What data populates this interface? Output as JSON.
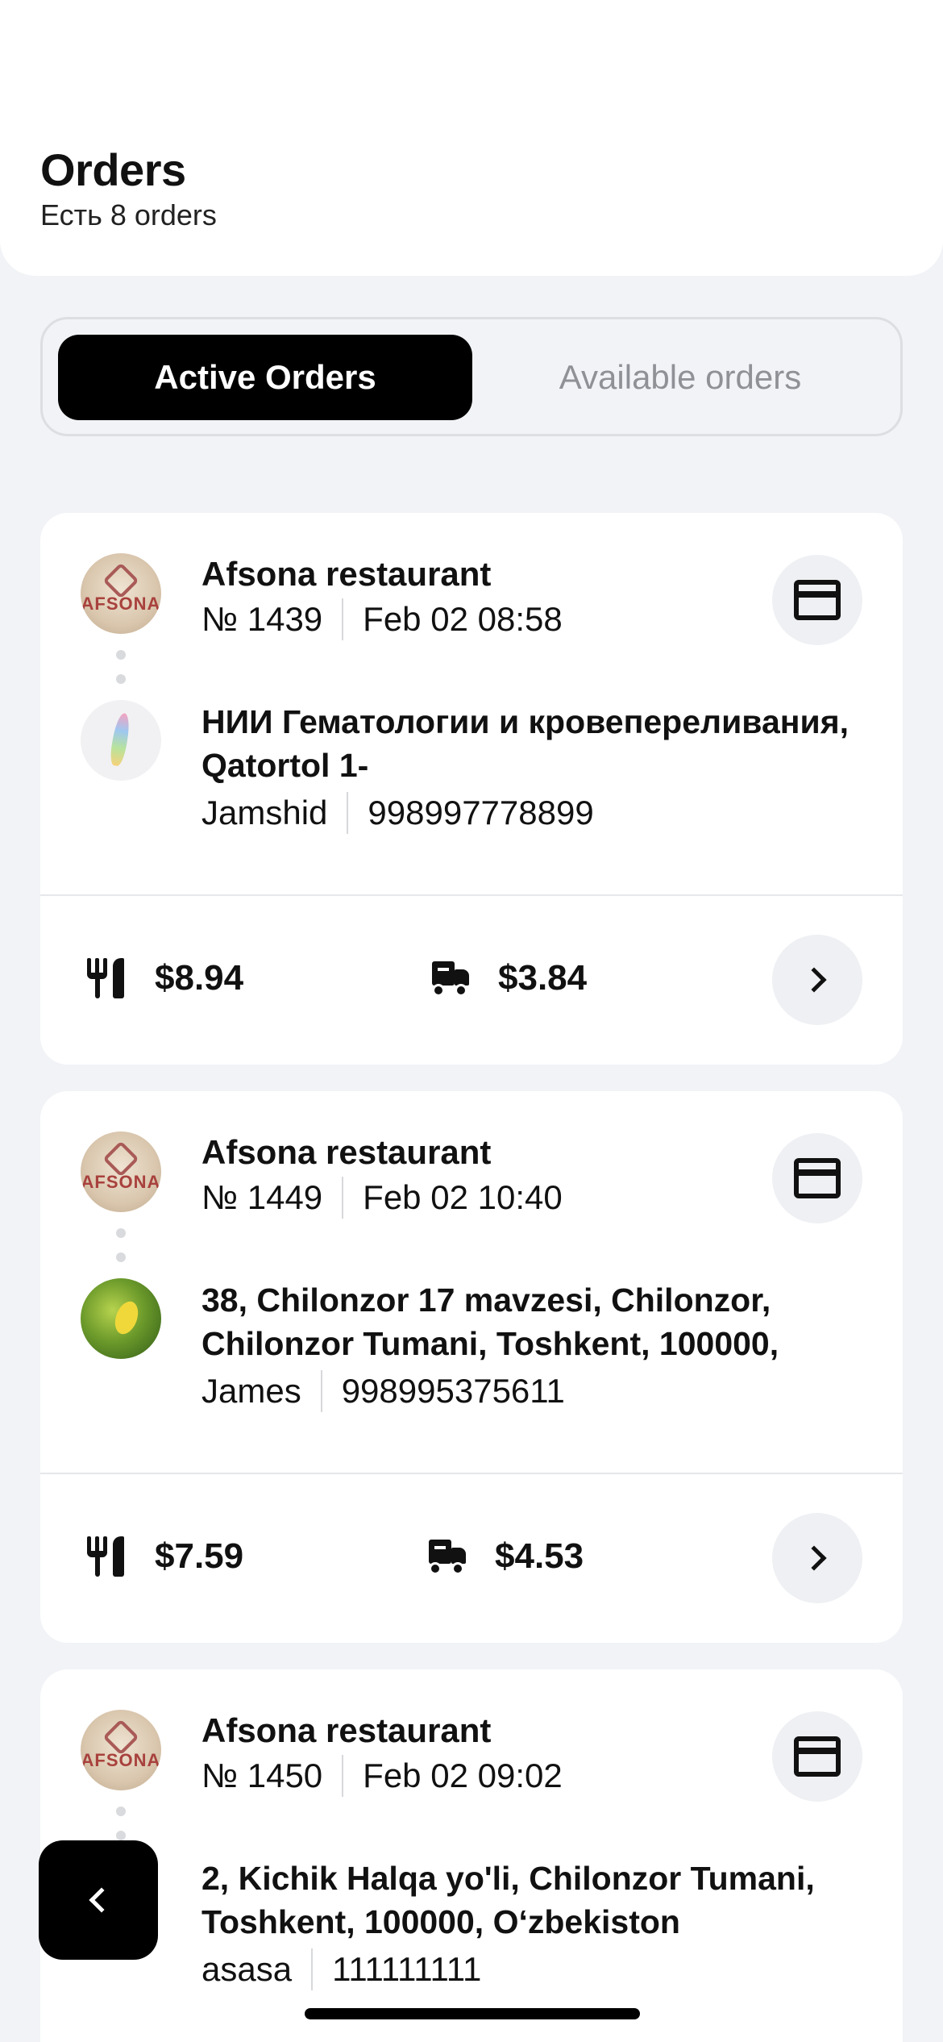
{
  "header": {
    "title": "Orders",
    "subtitle": "Есть 8 orders"
  },
  "tabs": {
    "active": "Active Orders",
    "available": "Available orders"
  },
  "orders": [
    {
      "restaurant": "Afsona restaurant",
      "restaurant_logo_text": "AFSONA",
      "number": "№ 1439",
      "datetime": "Feb 02 08:58",
      "address": "НИИ Гематологии и кровепереливания, Qatortol 1-",
      "customer": "Jamshid",
      "phone": "998997778899",
      "food_price": "$8.94",
      "delivery_price": "$3.84"
    },
    {
      "restaurant": "Afsona restaurant",
      "restaurant_logo_text": "AFSONA",
      "number": "№ 1449",
      "datetime": "Feb 02 10:40",
      "address": "38, Chilonzor 17 mavzesi, Chilonzor, Chilonzor Tumani, Toshkent, 100000,",
      "customer": "James",
      "phone": "998995375611",
      "food_price": "$7.59",
      "delivery_price": "$4.53"
    },
    {
      "restaurant": "Afsona restaurant",
      "restaurant_logo_text": "AFSONA",
      "number": "№ 1450",
      "datetime": "Feb 02 09:02",
      "address": "2, Kichik Halqa yo'li, Chilonzor Tumani, Toshkent, 100000, Oʻzbekiston",
      "customer": "asasa",
      "phone": "111111111"
    }
  ],
  "icons": {
    "card": "credit-card-icon",
    "food": "fork-knife-icon",
    "delivery": "delivery-truck-icon",
    "next": "chevron-right-icon",
    "back": "chevron-left-icon"
  }
}
